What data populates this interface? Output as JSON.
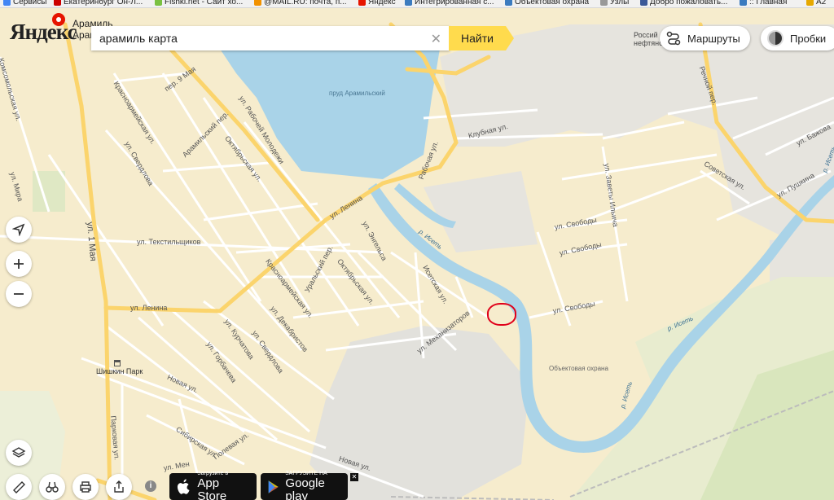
{
  "bookmarks": [
    {
      "label": "Сервисы",
      "color": "#4285f4"
    },
    {
      "label": "Екатеринбург Он-Л...",
      "color": "#cc0000"
    },
    {
      "label": "Fishki.net - Сайт хо...",
      "color": "#7ac142"
    },
    {
      "label": "@MAIL.RU: почта, п...",
      "color": "#f29200"
    },
    {
      "label": "Яндекс",
      "color": "#e61400"
    },
    {
      "label": "Интегрированная с...",
      "color": "#3b7bbf"
    },
    {
      "label": "Объектовая охрана",
      "color": "#3b7bbf"
    },
    {
      "label": "Узлы",
      "color": "#999999"
    },
    {
      "label": "Добро пожаловать...",
      "color": "#3b5998"
    },
    {
      "label": ":: Главная",
      "color": "#3b7bbf"
    },
    {
      "label": "A2",
      "color": "#e6a800"
    }
  ],
  "logo": {
    "text": "Яндекс",
    "placename_line1": "Арамиль",
    "placename_line2": "Арамил"
  },
  "search": {
    "value": "арамиль карта",
    "clear_icon": "close-icon",
    "find_label": "Найти"
  },
  "routes": {
    "label": "Маршруты",
    "icon": "route-icon"
  },
  "traffic": {
    "label": "Пробки",
    "icon": "traffic-icon"
  },
  "corner_label": {
    "line1": "Россий",
    "line2": "нефтяно"
  },
  "controls": {
    "locate": "locate-icon",
    "zoom_in": "plus-icon",
    "zoom_out": "minus-icon",
    "layers": "layers-icon",
    "ruler": "ruler-icon",
    "binoculars": "binoculars-icon",
    "print": "printer-icon",
    "share": "share-icon",
    "info": "info-icon"
  },
  "stores": {
    "appstore_small": "Загрузите в",
    "appstore_name": "App Store",
    "gplay_small": "ЗАГРУЗИТЕ НА",
    "gplay_name": "Google play",
    "close": "✕"
  },
  "map": {
    "colors": {
      "land": "#f6eccd",
      "water": "#a9d3e8",
      "industrial": "#e2e1dc",
      "road_main": "#fbd46c",
      "road": "#ffffff",
      "park": "#dfe8c4",
      "marker": "#e0001a"
    },
    "water_labels": [
      {
        "text": "пруд Арамильский"
      },
      {
        "text": "Объектовая охрана"
      }
    ],
    "poi": [
      {
        "text": "Шишкин Парк",
        "icon": "shop-icon"
      }
    ],
    "streets": [
      {
        "text": "Комсомольская ул."
      },
      {
        "text": "ул. Мира"
      },
      {
        "text": "Красноармейская ул."
      },
      {
        "text": "пер. 9 Мая"
      },
      {
        "text": "Арамильский пер."
      },
      {
        "text": "ул. Рабочей Молодежи"
      },
      {
        "text": "Октябрьская ул."
      },
      {
        "text": "ул. Свердлова"
      },
      {
        "text": "ул. Текстильщиков"
      },
      {
        "text": "ул. 1 Мая"
      },
      {
        "text": "ул. Ленина"
      },
      {
        "text": "ул. Ленина"
      },
      {
        "text": "ул. Энгельса"
      },
      {
        "text": "Уральский пер."
      },
      {
        "text": "Октябрьская ул."
      },
      {
        "text": "Красноармейская ул."
      },
      {
        "text": "ул. Курчатова"
      },
      {
        "text": "ул. Декабристов"
      },
      {
        "text": "ул. Свердлова"
      },
      {
        "text": "ул. Горбачева"
      },
      {
        "text": "Новая ул."
      },
      {
        "text": "Сибирская ул."
      },
      {
        "text": "Полевая ул."
      },
      {
        "text": "Новая ул."
      },
      {
        "text": "Парковая ул."
      },
      {
        "text": "ул. Механизаторов"
      },
      {
        "text": "Исетская ул."
      },
      {
        "text": "Рабочая ул."
      },
      {
        "text": "Клубная ул."
      },
      {
        "text": "ул. Свободы"
      },
      {
        "text": "ул. Свободы"
      },
      {
        "text": "ул. Свободы"
      },
      {
        "text": "ул. Заветы Ильича"
      },
      {
        "text": "Советская ул."
      },
      {
        "text": "ул. Пушкина"
      },
      {
        "text": "ул. Бажова"
      },
      {
        "text": "Речной пер."
      },
      {
        "text": "ул. Мен"
      }
    ],
    "rivers": [
      {
        "text": "р. Исеть"
      },
      {
        "text": "р. Исеть"
      },
      {
        "text": "р. Исеть"
      },
      {
        "text": "р. Исеть"
      }
    ]
  }
}
